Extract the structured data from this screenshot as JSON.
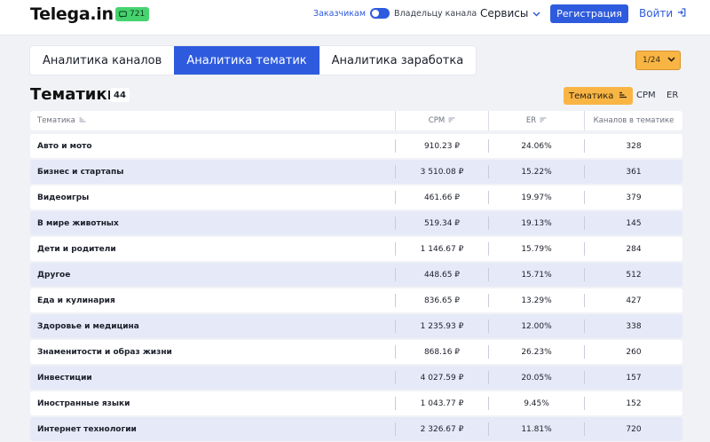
{
  "header": {
    "logo": "Telega.in",
    "badge_count": "721",
    "toggle_left_label": "Заказчикам",
    "toggle_right_label": "Владельцу канала",
    "services_label": "Сервисы",
    "register_label": "Регистрация",
    "login_label": "Войти"
  },
  "tabs": [
    {
      "label": "Аналитика каналов",
      "active": false
    },
    {
      "label": "Аналитика тематик",
      "active": true
    },
    {
      "label": "Аналитика заработка",
      "active": false
    }
  ],
  "pager": {
    "label": "1/24"
  },
  "page": {
    "title": "Тематики",
    "count": "44",
    "sort_options": [
      "Тематика",
      "CPM",
      "ER"
    ],
    "sort_active": "Тематика"
  },
  "table": {
    "columns": [
      "Тематика",
      "CPM",
      "ER",
      "Каналов в тематике"
    ],
    "rows": [
      {
        "name": "Авто и мото",
        "cpm": "910.23 ₽",
        "er": "24.06%",
        "channels": "328"
      },
      {
        "name": "Бизнес и стартапы",
        "cpm": "3 510.08 ₽",
        "er": "15.22%",
        "channels": "361"
      },
      {
        "name": "Видеоигры",
        "cpm": "461.66 ₽",
        "er": "19.97%",
        "channels": "379"
      },
      {
        "name": "В мире животных",
        "cpm": "519.34 ₽",
        "er": "19.13%",
        "channels": "145"
      },
      {
        "name": "Дети и родители",
        "cpm": "1 146.67 ₽",
        "er": "15.79%",
        "channels": "284"
      },
      {
        "name": "Другое",
        "cpm": "448.65 ₽",
        "er": "15.71%",
        "channels": "512"
      },
      {
        "name": "Еда и кулинария",
        "cpm": "836.65 ₽",
        "er": "13.29%",
        "channels": "427"
      },
      {
        "name": "Здоровье и медицина",
        "cpm": "1 235.93 ₽",
        "er": "12.00%",
        "channels": "338"
      },
      {
        "name": "Знаменитости и образ жизни",
        "cpm": "868.16 ₽",
        "er": "26.23%",
        "channels": "260"
      },
      {
        "name": "Инвестиции",
        "cpm": "4 027.59 ₽",
        "er": "20.05%",
        "channels": "157"
      },
      {
        "name": "Иностранные языки",
        "cpm": "1 043.77 ₽",
        "er": "9.45%",
        "channels": "152"
      },
      {
        "name": "Интернет технологии",
        "cpm": "2 326.67 ₽",
        "er": "11.81%",
        "channels": "720"
      }
    ]
  },
  "colors": {
    "accent": "#2e5bde",
    "badge": "#46d36f",
    "highlight": "#f9b544",
    "row_alt": "#e6eaf8"
  },
  "icons": {
    "badge": "chat-icon",
    "services": "chevron-down-icon",
    "login": "login-arrow-icon",
    "pager": "chevron-down-icon",
    "sort": "sort-lines-icon"
  }
}
